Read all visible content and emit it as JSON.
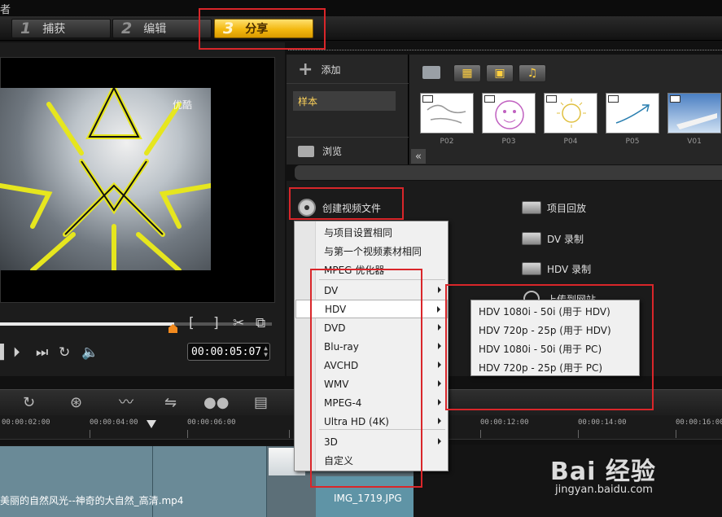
{
  "window": {
    "title_fragment": "者"
  },
  "steps": [
    {
      "num": "1",
      "label": "捕获"
    },
    {
      "num": "2",
      "label": "编辑"
    },
    {
      "num": "3",
      "label": "分享"
    }
  ],
  "preview": {
    "video_watermark": "优酷",
    "timecode": "00:00:05:07",
    "progress_fraction": 0.64
  },
  "library": {
    "add_label": "添加",
    "folder_label": "样本",
    "browse_label": "浏览",
    "thumbnails": [
      "P02",
      "P03",
      "P04",
      "P05",
      "V01"
    ]
  },
  "share": {
    "create_video": "创建视频文件",
    "project_playback": "项目回放",
    "dv_record": "DV 录制",
    "hdv_record": "HDV 录制",
    "upload_web": "上传到网站"
  },
  "menu": {
    "items": [
      {
        "label": "与项目设置相同",
        "submenu": false
      },
      {
        "label": "与第一个视频素材相同",
        "submenu": false
      },
      {
        "label": "MPEG 优化器",
        "submenu": false
      },
      {
        "label": "DV",
        "submenu": true
      },
      {
        "label": "HDV",
        "submenu": true
      },
      {
        "label": "DVD",
        "submenu": true
      },
      {
        "label": "Blu-ray",
        "submenu": true
      },
      {
        "label": "AVCHD",
        "submenu": true
      },
      {
        "label": "WMV",
        "submenu": true
      },
      {
        "label": "MPEG-4",
        "submenu": true
      },
      {
        "label": "Ultra HD (4K)",
        "submenu": true
      },
      {
        "label": "3D",
        "submenu": true
      },
      {
        "label": "自定义",
        "submenu": false
      }
    ],
    "selected": "HDV"
  },
  "submenu": {
    "items": [
      "HDV 1080i - 50i  (用于 HDV)",
      "HDV 720p - 25p  (用于 HDV)",
      "HDV 1080i - 50i  (用于 PC)",
      "HDV 720p - 25p  (用于 PC)"
    ]
  },
  "timeline": {
    "ruler": [
      "00:00:02:00",
      "00:00:04:00",
      "00:00:06:00",
      "00:00:12:00",
      "00:00:14:00",
      "00:00:16:00"
    ],
    "clip_video_name": "美丽的自然风光--神奇的大自然_高清.mp4",
    "clip_image_name": "IMG_1719.JPG"
  },
  "watermark": {
    "brand": "Bai 经验",
    "url": "jingyan.baidu.com"
  },
  "colors": {
    "accent_gold": "#f3b810",
    "highlight_red": "#d9262a",
    "clip_teal": "#6a8a97"
  }
}
